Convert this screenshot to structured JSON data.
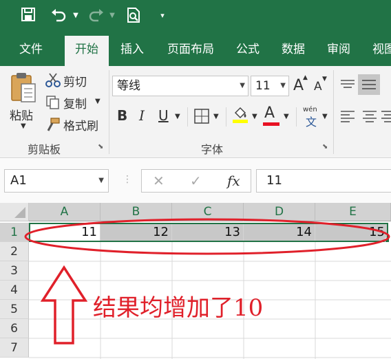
{
  "titlebar": {
    "save_icon": "save-icon",
    "undo_icon": "undo-icon",
    "redo_icon": "redo-icon",
    "print_preview_icon": "print-preview-icon",
    "customize_icon": "customize-quick-access-icon"
  },
  "tabs": [
    {
      "label": "文件",
      "active": false
    },
    {
      "label": "开始",
      "active": true
    },
    {
      "label": "插入",
      "active": false
    },
    {
      "label": "页面布局",
      "active": false
    },
    {
      "label": "公式",
      "active": false
    },
    {
      "label": "数据",
      "active": false
    },
    {
      "label": "审阅",
      "active": false
    },
    {
      "label": "视图",
      "active": false
    }
  ],
  "ribbon": {
    "clipboard": {
      "paste": "粘贴",
      "cut": "剪切",
      "copy": "复制",
      "format_painter": "格式刷",
      "group_label": "剪贴板"
    },
    "font": {
      "font_name": "等线",
      "font_size": "11",
      "grow": "A",
      "shrink": "A",
      "bold": "B",
      "italic": "I",
      "underline": "U",
      "font_color": "A",
      "phonetic_top": "wén",
      "phonetic_bottom": "文",
      "group_label": "字体"
    },
    "colors": {
      "highlight": "#ffff00",
      "font_color": "#e81123"
    }
  },
  "formula_bar": {
    "name_box": "A1",
    "cancel": "✕",
    "enter": "✓",
    "fx": "fx",
    "value": "11"
  },
  "grid": {
    "columns": [
      "A",
      "B",
      "C",
      "D",
      "E"
    ],
    "rows": [
      "1",
      "2",
      "3",
      "4",
      "5",
      "6",
      "7"
    ],
    "row1_values": [
      "11",
      "12",
      "13",
      "14",
      "15"
    ]
  },
  "annotation": {
    "text": "结果均增加了10",
    "color": "#e0202a"
  }
}
